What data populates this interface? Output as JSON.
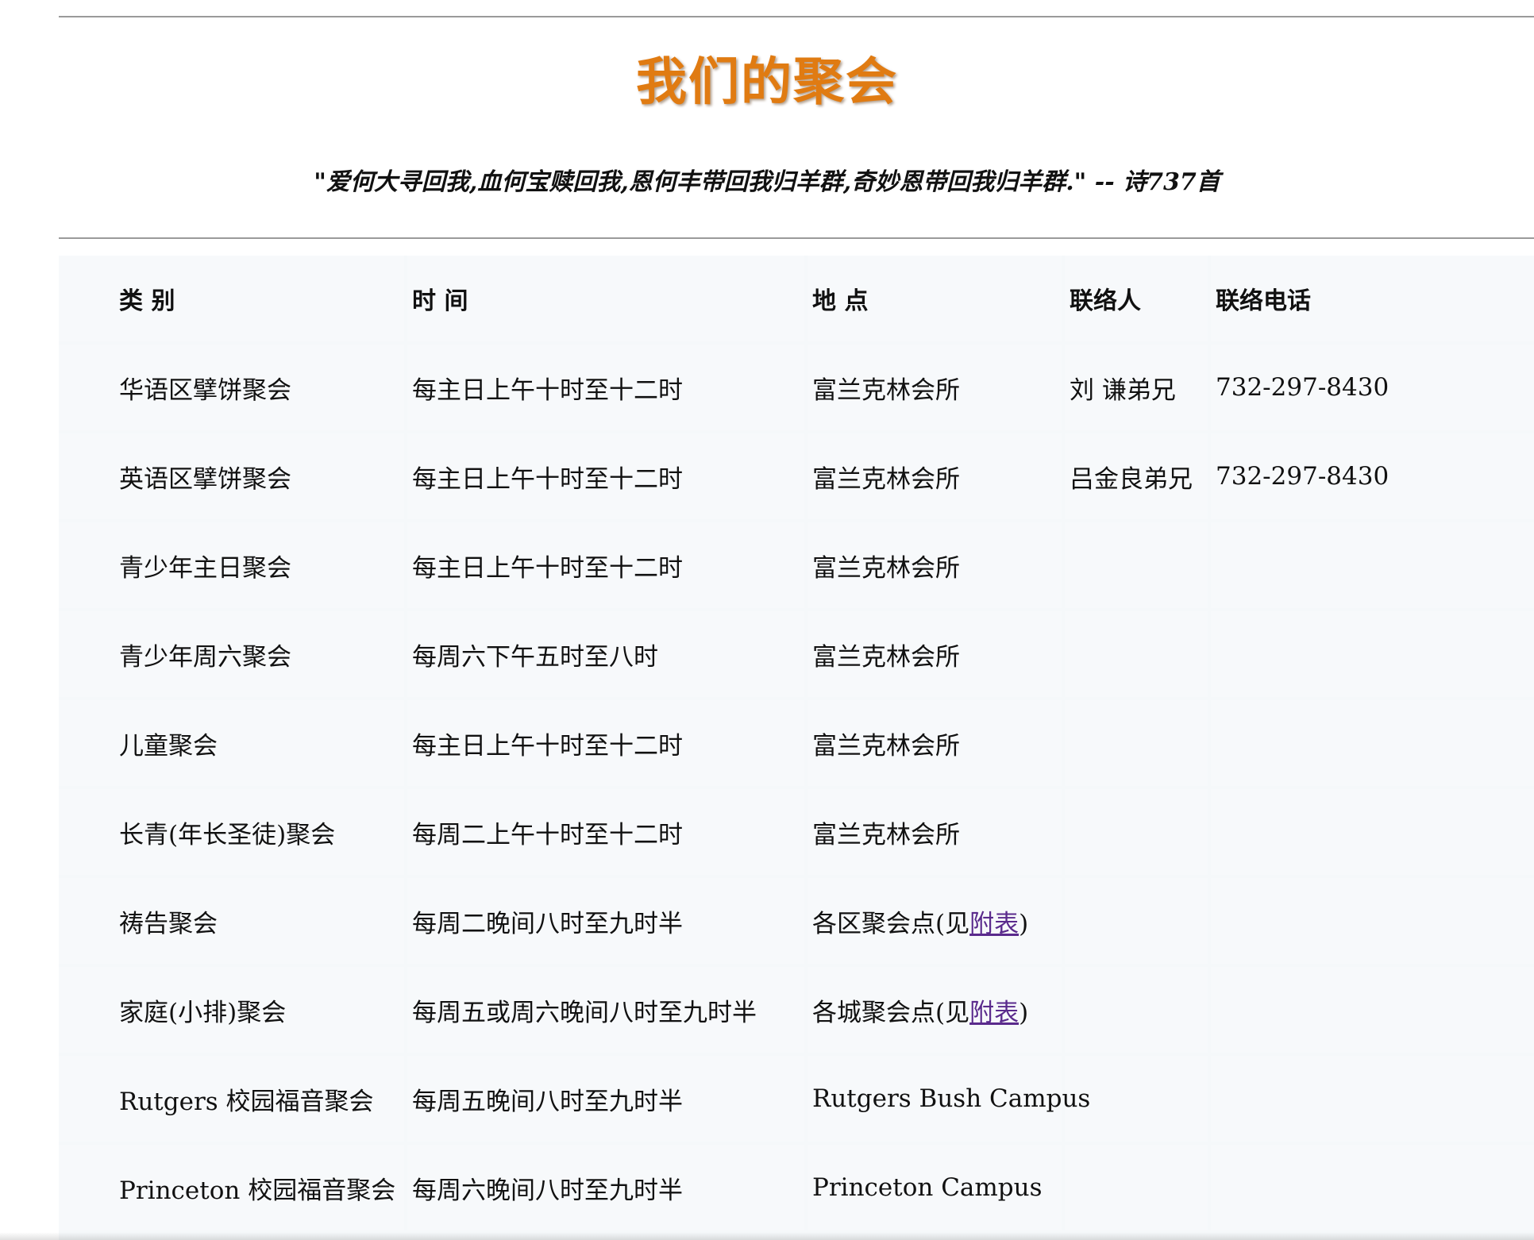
{
  "page": {
    "title": "我们的聚会",
    "quote": "\"爱何大寻回我,血何宝赎回我,恩何丰带回我归羊群,奇妙恩带回我归羊群.\" -- 诗737首"
  },
  "table": {
    "headers": [
      "类 别",
      "时 间",
      "地 点",
      "联络人",
      "联络电话"
    ],
    "rows": [
      {
        "type": "华语区擘饼聚会",
        "time": "每主日上午十时至十二时",
        "place": "富兰克林会所",
        "contact": "刘 谦弟兄",
        "phone": "732-297-8430"
      },
      {
        "type": "英语区擘饼聚会",
        "time": "每主日上午十时至十二时",
        "place": "富兰克林会所",
        "contact": "吕金良弟兄",
        "phone": "732-297-8430"
      },
      {
        "type": "青少年主日聚会",
        "time": "每主日上午十时至十二时",
        "place": "富兰克林会所",
        "contact": "",
        "phone": ""
      },
      {
        "type": "青少年周六聚会",
        "time": "每周六下午五时至八时",
        "place": "富兰克林会所",
        "contact": "",
        "phone": ""
      },
      {
        "type": "儿童聚会",
        "time": "每主日上午十时至十二时",
        "place": "富兰克林会所",
        "contact": "",
        "phone": ""
      },
      {
        "type": "长青(年长圣徒)聚会",
        "time": "每周二上午十时至十二时",
        "place": "富兰克林会所",
        "contact": "",
        "phone": ""
      },
      {
        "type": "祷告聚会",
        "time": "每周二晚间八时至九时半",
        "place_prefix": "各区聚会点(见",
        "place_link": "附表",
        "place_suffix": ")",
        "contact": "",
        "phone": ""
      },
      {
        "type": "家庭(小排)聚会",
        "time": "每周五或周六晚间八时至九时半",
        "place_prefix": "各城聚会点(见",
        "place_link": "附表",
        "place_suffix": ")",
        "contact": "",
        "phone": ""
      },
      {
        "type": "Rutgers 校园福音聚会",
        "time": "每周五晚间八时至九时半",
        "place": "Rutgers Bush Campus",
        "contact": "",
        "phone": ""
      },
      {
        "type": "Princeton 校园福音聚会",
        "time": "每周六晚间八时至九时半",
        "place": "Princeton Campus",
        "contact": "",
        "phone": ""
      }
    ]
  }
}
